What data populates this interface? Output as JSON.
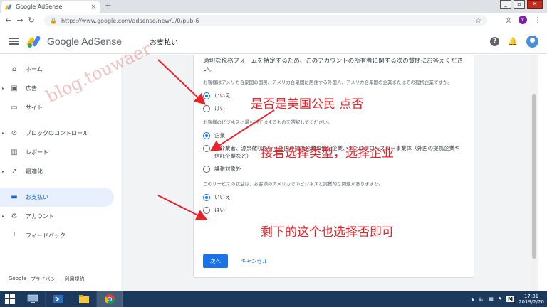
{
  "browser": {
    "tab_title": "Google AdSense",
    "url": "https://www.google.com/adsense/new/u/0/pub-6",
    "profile_initial": "x"
  },
  "header": {
    "logo_text": "Google AdSense",
    "page_title": "お支払い",
    "help": "?"
  },
  "sidebar": {
    "items": [
      {
        "label": "ホーム",
        "icon": "home-icon",
        "glyph": "⌂"
      },
      {
        "label": "広告",
        "icon": "ads-icon",
        "glyph": "▣"
      },
      {
        "label": "サイト",
        "icon": "sites-icon",
        "glyph": "▭"
      },
      {
        "label": "ブロックのコントロール",
        "icon": "block-icon",
        "glyph": "⊘"
      },
      {
        "label": "レポート",
        "icon": "reports-icon",
        "glyph": "▥"
      },
      {
        "label": "最適化",
        "icon": "optimization-icon",
        "glyph": "↗"
      },
      {
        "label": "お支払い",
        "icon": "payments-icon",
        "glyph": "▬"
      },
      {
        "label": "アカウント",
        "icon": "account-icon",
        "glyph": "⚙"
      },
      {
        "label": "フィードバック",
        "icon": "feedback-icon",
        "glyph": "!"
      }
    ],
    "footer": {
      "brand": "Google",
      "privacy": "プライバシー",
      "terms": "利用規約"
    }
  },
  "form": {
    "intro": "適切な税務フォームを特定するため、このアカウントの所有者に関する次の質問にお答えください。",
    "q1": {
      "text": "お客様はアメリカ合衆国の国民、アメリカ合衆国に居住する外国人、アメリカ合衆国の企業またはその提携企業ですか。",
      "options": [
        "いいえ",
        "はい"
      ]
    },
    "q2": {
      "text": "お客様のビジネスに最も当てはまるものを選択してください。",
      "options": [
        "企業",
        "仲介業者、源泉徴収を行う外国の提携企業や信託企業、またはフロースルー事業体（外国の提携企業や信託企業など）",
        "課税対象外"
      ]
    },
    "q3": {
      "text": "このサービスの収益は、お客様のアメリカでのビジネスと実質的な関連がありますか。",
      "options": [
        "いいえ",
        "はい"
      ]
    },
    "next_label": "次へ",
    "cancel_label": "キャンセル"
  },
  "annotations": {
    "a1": "是否是美国公民  点否",
    "a2": "接着选择类型，选择企业",
    "a3": "剩下的这个也选择否即可",
    "watermark": "blog.touwaer"
  },
  "taskbar": {
    "time": "17:31",
    "date": "2019/2/20",
    "ime": "M"
  }
}
